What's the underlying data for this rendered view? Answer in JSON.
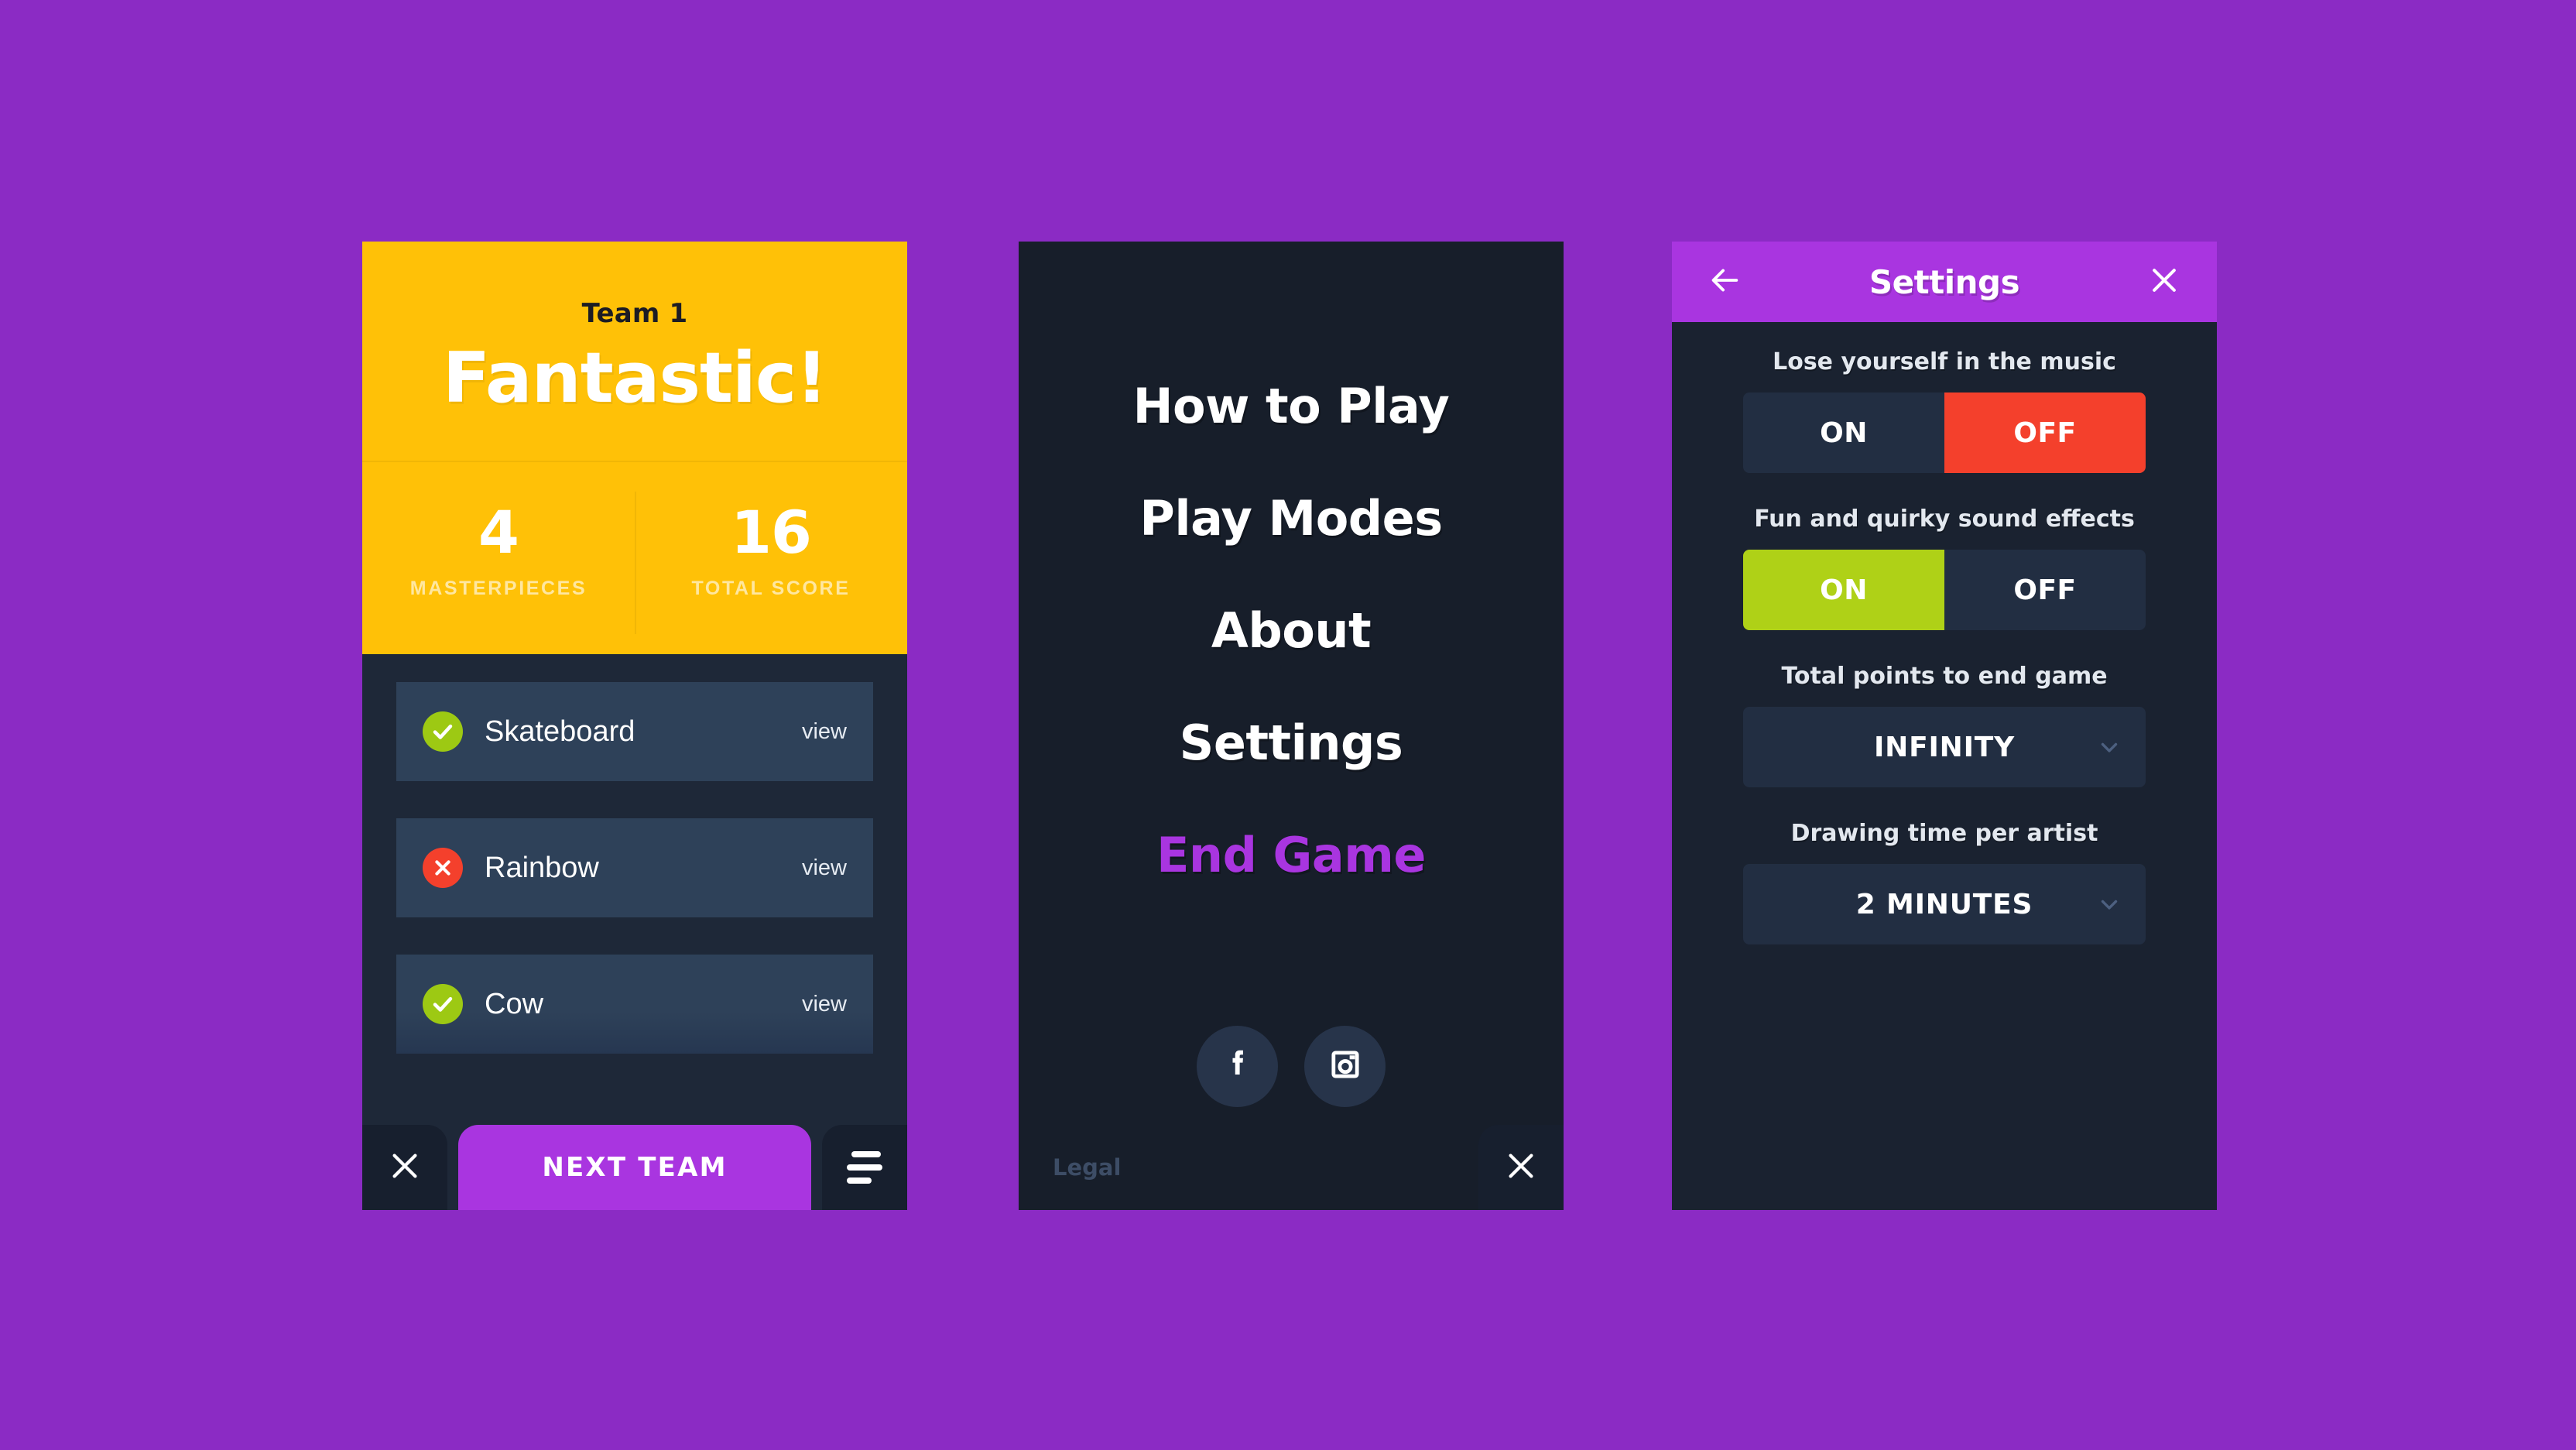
{
  "theme": {
    "background": "#8b2bc4",
    "accent_purple": "#a935e0",
    "yellow": "#ffc107",
    "panel_dark": "#1e2838",
    "menu_dark": "#171e2a",
    "settings_dark": "#1a2230",
    "row_blue": "#2e4159",
    "green": "#afd117",
    "red": "#f4402c"
  },
  "score_panel": {
    "team_name": "Team 1",
    "verdict": "Fantastic!",
    "stats": [
      {
        "value": "4",
        "label": "MASTERPIECES"
      },
      {
        "value": "16",
        "label": "TOTAL SCORE"
      }
    ],
    "drawings": [
      {
        "status": "check",
        "name": "Skateboard",
        "action": "view"
      },
      {
        "status": "cross",
        "name": "Rainbow",
        "action": "view"
      },
      {
        "status": "check",
        "name": "Cow",
        "action": "view"
      }
    ],
    "bottom_bar": {
      "close_icon": "close-icon",
      "primary_label": "NEXT TEAM",
      "menu_icon": "hamburger-icon"
    }
  },
  "menu_panel": {
    "items": [
      {
        "label": "How to Play",
        "accent": false
      },
      {
        "label": "Play Modes",
        "accent": false
      },
      {
        "label": "About",
        "accent": false
      },
      {
        "label": "Settings",
        "accent": false
      },
      {
        "label": "End Game",
        "accent": true
      }
    ],
    "socials": [
      {
        "icon": "facebook-icon",
        "name": "Facebook"
      },
      {
        "icon": "instagram-icon",
        "name": "Instagram"
      }
    ],
    "legal_label": "Legal",
    "close_icon": "close-icon"
  },
  "settings_panel": {
    "header": {
      "back_icon": "arrow-left-icon",
      "title": "Settings",
      "close_icon": "close-icon"
    },
    "rows": [
      {
        "label": "Lose yourself in the music",
        "type": "segmented",
        "options": [
          "ON",
          "OFF"
        ],
        "selected": "OFF",
        "selected_color": "#f4402c"
      },
      {
        "label": "Fun and quirky sound effects",
        "type": "segmented",
        "options": [
          "ON",
          "OFF"
        ],
        "selected": "ON",
        "selected_color": "#afd117"
      },
      {
        "label": "Total points to end game",
        "type": "dropdown",
        "value": "INFINITY",
        "chevron": "chevron-down-icon"
      },
      {
        "label": "Drawing time per artist",
        "type": "dropdown",
        "value": "2 MINUTES",
        "chevron": "chevron-down-icon"
      }
    ]
  }
}
